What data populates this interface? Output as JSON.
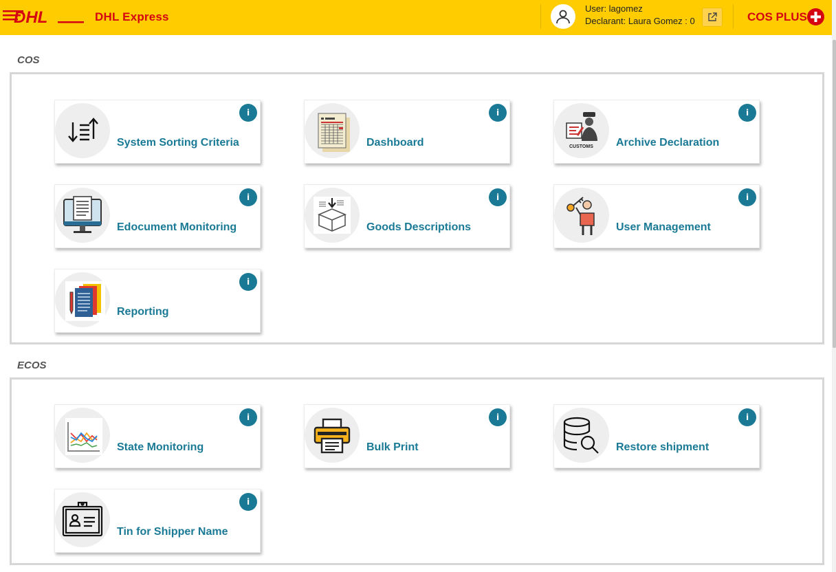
{
  "header": {
    "brand_logo_text": "DHL",
    "app_title": "DHL Express",
    "user_line": "User: lagomez",
    "declarant_line": "Declarant: Laura Gomez : 0",
    "plus_label": "COS PLUS",
    "colors": {
      "bar": "#ffcc00",
      "brand_red": "#d40511"
    }
  },
  "sections": [
    {
      "title": "COS",
      "tiles": [
        {
          "label": "System Sorting Criteria",
          "icon": "sort-icon",
          "info": "i"
        },
        {
          "label": "Dashboard",
          "icon": "spreadsheet-icon",
          "info": "i"
        },
        {
          "label": "Archive Declaration",
          "icon": "customs-officer-icon",
          "info": "i"
        },
        {
          "label": "Edocument Monitoring",
          "icon": "monitor-document-icon",
          "info": "i"
        },
        {
          "label": "Goods Descriptions",
          "icon": "box-icon",
          "info": "i"
        },
        {
          "label": "User Management",
          "icon": "user-key-icon",
          "info": "i"
        },
        {
          "label": "Reporting",
          "icon": "report-folders-icon",
          "info": "i"
        }
      ]
    },
    {
      "title": "ECOS",
      "tiles": [
        {
          "label": "State Monitoring",
          "icon": "line-chart-icon",
          "info": "i"
        },
        {
          "label": "Bulk Print",
          "icon": "printer-icon",
          "info": "i"
        },
        {
          "label": "Restore shipment",
          "icon": "database-search-icon",
          "info": "i"
        },
        {
          "label": "Tin for Shipper Name",
          "icon": "id-badge-icon",
          "info": "i"
        }
      ]
    }
  ],
  "accent_color": "#1a7a96"
}
